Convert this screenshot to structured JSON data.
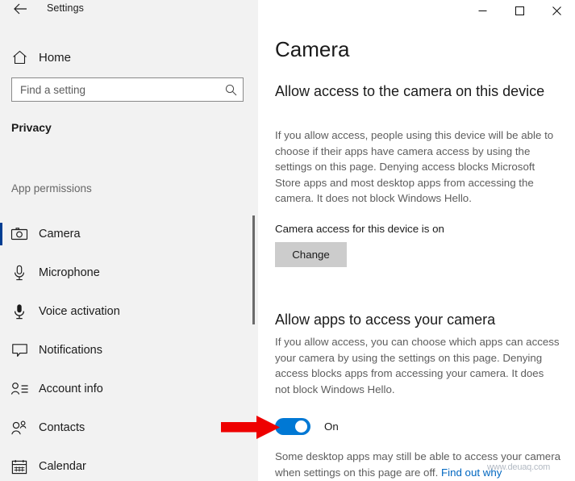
{
  "window": {
    "title": "Settings",
    "back_icon": "back-arrow-icon",
    "controls": {
      "minimize": "─",
      "maximize": "☐",
      "close": "✕"
    }
  },
  "sidebar": {
    "home_label": "Home",
    "home_icon": "home-icon",
    "search": {
      "placeholder": "Find a setting",
      "value": "",
      "icon": "search-icon"
    },
    "section_title": "Privacy",
    "group_label": "App permissions",
    "items": [
      {
        "label": "Camera",
        "icon": "camera-icon",
        "selected": true
      },
      {
        "label": "Microphone",
        "icon": "microphone-icon",
        "selected": false
      },
      {
        "label": "Voice activation",
        "icon": "voice-activation-icon",
        "selected": false
      },
      {
        "label": "Notifications",
        "icon": "notification-bubble-icon",
        "selected": false
      },
      {
        "label": "Account info",
        "icon": "account-info-icon",
        "selected": false
      },
      {
        "label": "Contacts",
        "icon": "contacts-icon",
        "selected": false
      },
      {
        "label": "Calendar",
        "icon": "calendar-icon",
        "selected": false
      }
    ]
  },
  "main": {
    "page_title": "Camera",
    "section1": {
      "heading": "Allow access to the camera on this device",
      "body": "If you allow access, people using this device will be able to choose if their apps have camera access by using the settings on this page. Denying access blocks Microsoft Store apps and most desktop apps from accessing the camera. It does not block Windows Hello.",
      "status": "Camera access for this device is on",
      "change_button": "Change"
    },
    "section2": {
      "heading": "Allow apps to access your camera",
      "body": "If you allow access, you can choose which apps can access your camera by using the settings on this page. Denying access blocks apps from accessing your camera. It does not block Windows Hello.",
      "toggle_state": "On",
      "footnote_text": "Some desktop apps may still be able to access your camera when settings on this page are off. ",
      "footnote_link": "Find out why"
    }
  },
  "annotation": {
    "arrow_icon": "red-arrow-right-icon",
    "arrow_color": "#ee0000"
  },
  "watermark": {
    "text": "www.deuaq.com"
  },
  "colors": {
    "accent_blue": "#0078d4",
    "selection_bar": "#003e92",
    "sidebar_bg": "#f2f2f2",
    "content_bg": "#ffffff",
    "link": "#0067c0"
  }
}
